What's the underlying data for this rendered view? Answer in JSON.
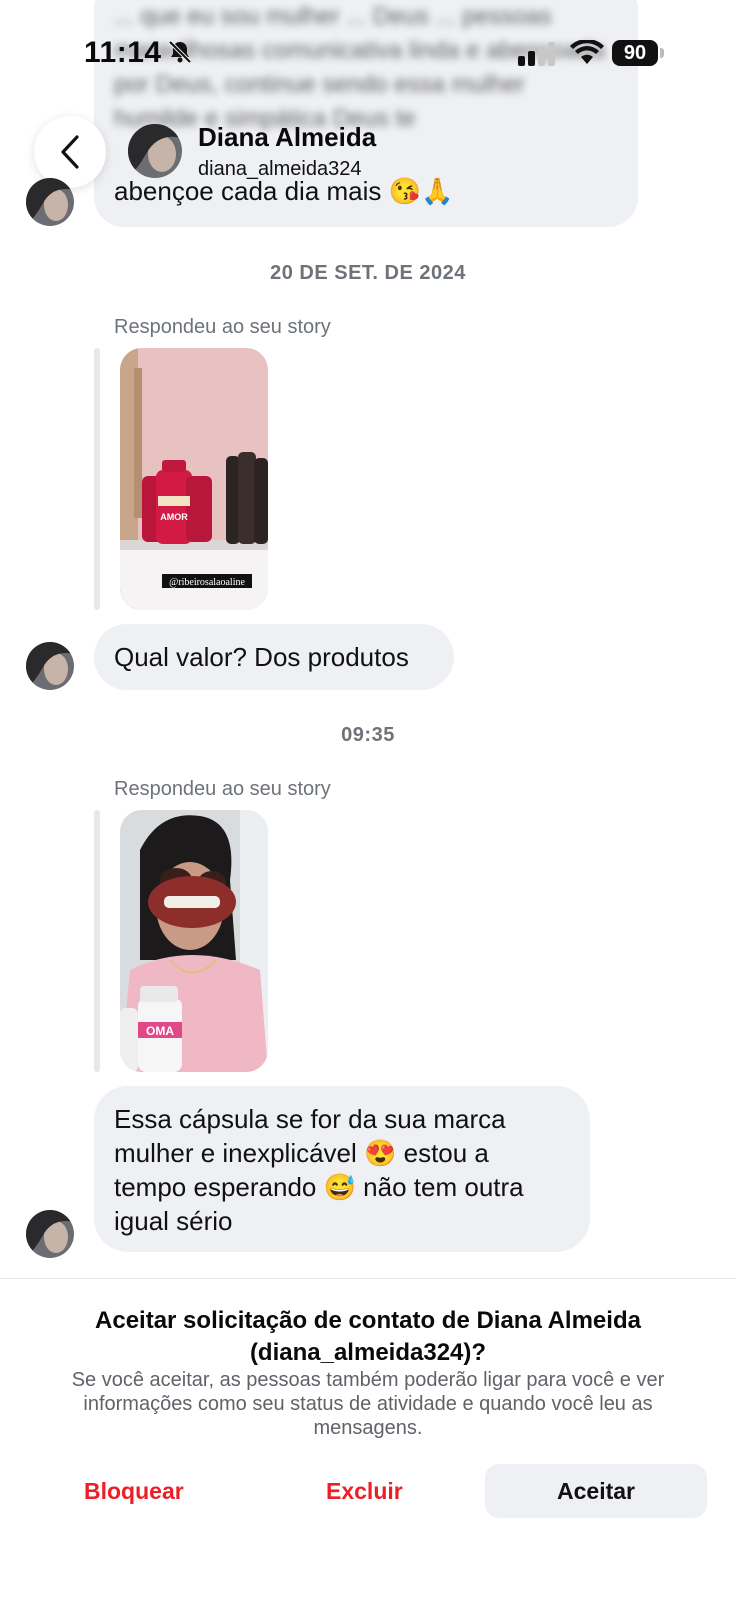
{
  "status_bar": {
    "time": "11:14",
    "battery": "90"
  },
  "header": {
    "name": "Diana Almeida",
    "username": "diana_almeida324"
  },
  "messages": {
    "top_blurred_text": "... que eu sou mulher ... Deus ... pessoas maravilhosas comunicativa linda e abençoada por Deus, continue sendo essa mulher humilde e simpática Deus te",
    "top_last_line": "abençoe cada dia mais 😘🙏",
    "date_1": "20 DE SET. DE 2024",
    "reply_label_1": "Respondeu ao seu story",
    "story_1_caption": "@ribeirosalaoaline",
    "story_1_product": "AMOR",
    "bubble_1": "Qual valor? Dos produtos",
    "time_2": "09:35",
    "reply_label_2": "Respondeu ao seu story",
    "story_2_product": "OMA",
    "bubble_2_lines": [
      "Essa cápsula se for  da sua marca",
      "mulher e inexplicável 😍   estou a",
      "tempo esperando 😅 não tem outra",
      "igual sério"
    ]
  },
  "request": {
    "title": "Aceitar solicitação de contato de Diana Almeida (diana_almeida324)?",
    "body": "Se você aceitar, as pessoas também poderão ligar para você e ver informações como seu status de atividade e quando você leu as mensagens.",
    "block_label": "Bloquear",
    "delete_label": "Excluir",
    "accept_label": "Aceitar"
  },
  "colors": {
    "danger": "#ED1F26",
    "bubble": "#EEF0F3",
    "meta_text": "#6E7379"
  }
}
